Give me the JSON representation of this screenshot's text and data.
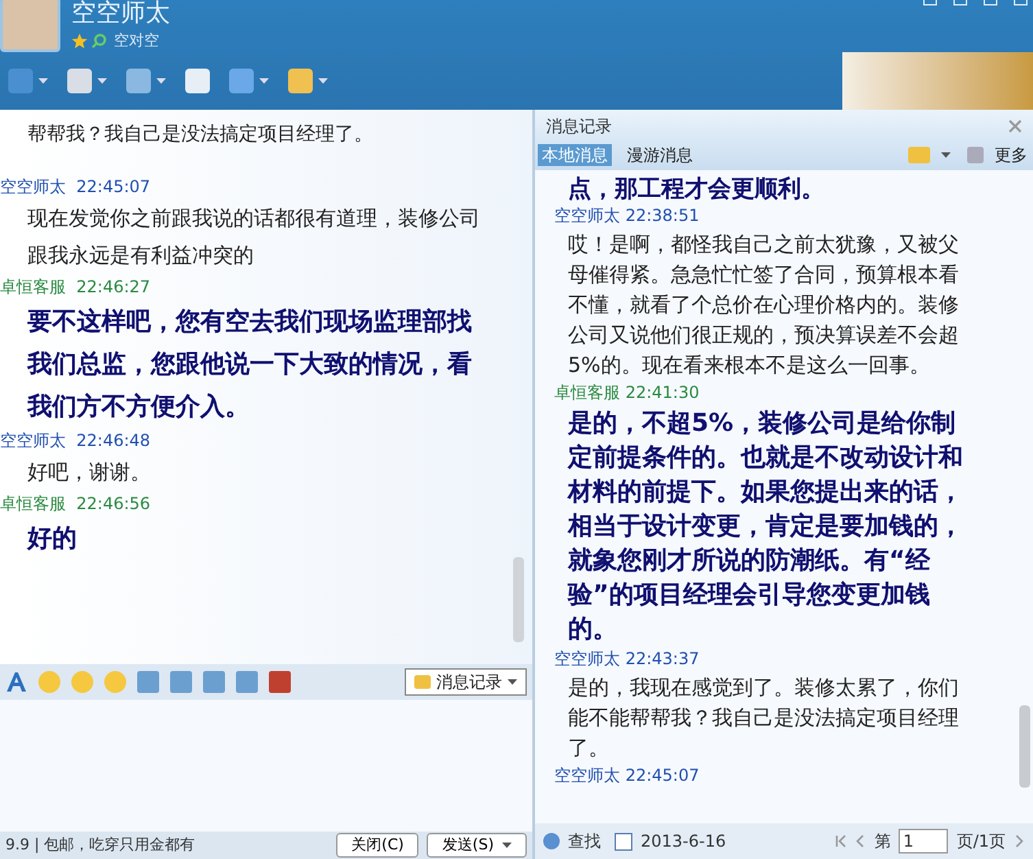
{
  "contact": {
    "name": "空空师太",
    "signature": "空对空"
  },
  "chat": {
    "messages": [
      {
        "kind": "cut",
        "text": "帮帮我？我自己是没法搞定项目经理了。"
      },
      {
        "kind": "self",
        "sender": "空空师太",
        "time": "22:45:07",
        "text": "现在发觉你之前跟我说的话都很有道理，装修公司跟我永远是有利益冲突的"
      },
      {
        "kind": "agent",
        "sender": "卓恒客服",
        "time": "22:46:27",
        "text": "要不这样吧，您有空去我们现场监理部找我们总监，您跟他说一下大致的情况，看我们方不方便介入。"
      },
      {
        "kind": "self",
        "sender": "空空师太",
        "time": "22:46:48",
        "text": "好吧，谢谢。"
      },
      {
        "kind": "agent",
        "sender": "卓恒客服",
        "time": "22:46:56",
        "text": "好的"
      }
    ]
  },
  "history_button": "消息记录",
  "status_text": "9.9 | 包邮，吃穿只用金都有",
  "buttons": [
    "关闭(C)",
    "发送(S)"
  ],
  "history": {
    "title": "消息记录",
    "more": "更多",
    "tabs": [
      {
        "label": "本地消息",
        "selected": true
      },
      {
        "label": "漫游消息",
        "selected": false
      }
    ],
    "messages": [
      {
        "kind": "cut",
        "text": "点，那工程才会更顺利。"
      },
      {
        "kind": "self",
        "sender": "空空师太",
        "time": "22:38:51",
        "text": "哎！是啊，都怪我自己之前太犹豫，又被父母催得紧。急急忙忙签了合同，预算根本看不懂，就看了个总价在心理价格内的。装修公司又说他们很正规的，预决算误差不会超5%的。现在看来根本不是这么一回事。"
      },
      {
        "kind": "agent",
        "sender": "卓恒客服",
        "time": "22:41:30",
        "text": "是的，不超5%，装修公司是给你制定前提条件的。也就是不改动设计和材料的前提下。如果您提出来的话，相当于设计变更，肯定是要加钱的，就象您刚才所说的防潮纸。有“经验”的项目经理会引导您变更加钱的。"
      },
      {
        "kind": "self",
        "sender": "空空师太",
        "time": "22:43:37",
        "text": "是的，我现在感觉到了。装修太累了，你们能不能帮帮我？我自己是没法搞定项目经理了。"
      },
      {
        "kind": "self",
        "sender": "空空师太",
        "time": "22:45:07"
      }
    ],
    "search": "查找",
    "date": "2013-6-16",
    "page_prefix": "第",
    "page": "1",
    "page_suffix": "页/1页"
  }
}
